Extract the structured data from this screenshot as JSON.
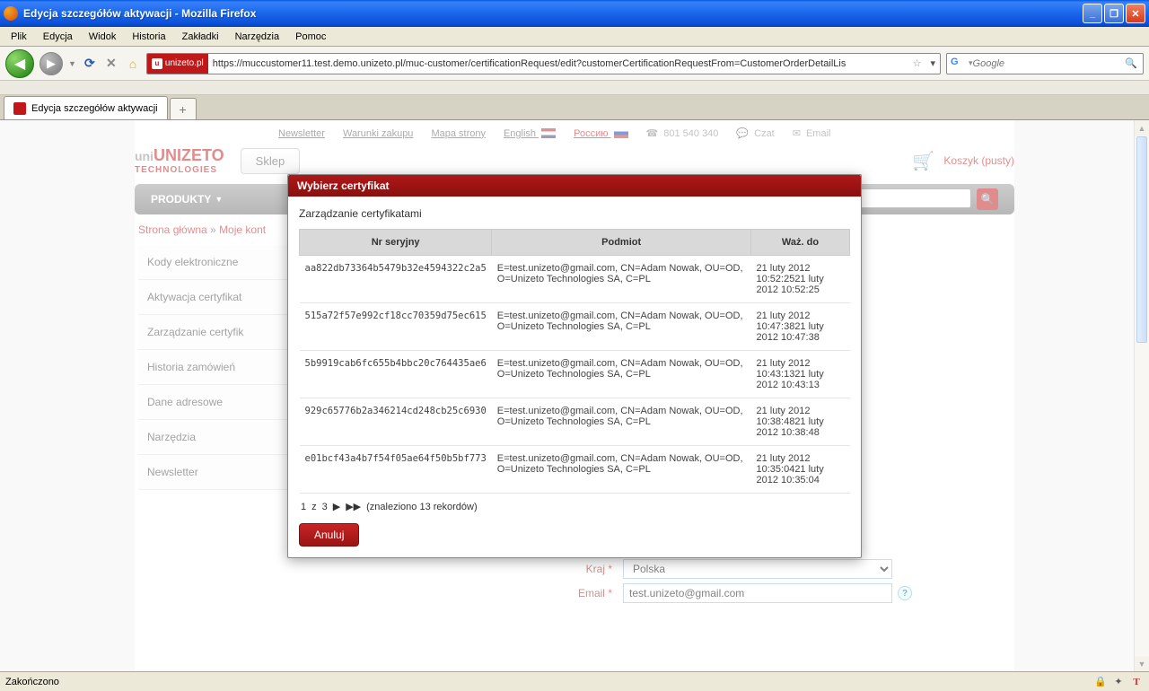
{
  "window": {
    "title": "Edycja szczegółów aktywacji - Mozilla Firefox"
  },
  "menubar": {
    "items": [
      "Plik",
      "Edycja",
      "Widok",
      "Historia",
      "Zakładki",
      "Narzędzia",
      "Pomoc"
    ]
  },
  "toolbar": {
    "site_id": "unizeto.pl",
    "url": "https://muccustomer11.test.demo.unizeto.pl/muc-customer/certificationRequest/edit?customerCertificationRequestFrom=CustomerOrderDetailLis",
    "search_placeholder": "Google"
  },
  "tabs": {
    "active_title": "Edycja szczegółów aktywacji"
  },
  "page": {
    "toplinks": {
      "newsletter": "Newsletter",
      "warunki": "Warunki zakupu",
      "mapa": "Mapa strony",
      "english": "English",
      "russian": "Россию",
      "phone": "801 540 340",
      "czat": "Czat",
      "email": "Email"
    },
    "logo_line1": "UNIZETO",
    "logo_line2": "TECHNOLOGIES",
    "sklep": "Sklep",
    "cart": "Koszyk (pusty)",
    "navbar": {
      "produkty": "PRODUKTY"
    },
    "breadcrumb": {
      "home": "Strona główna",
      "sep": " » ",
      "current": "Moje kont"
    },
    "sidenav": [
      "Kody elektroniczne",
      "Aktywacja certyfikat",
      "Zarządzanie certyfik",
      "Historia zamówień",
      "Dane adresowe",
      "Narzędzia",
      "Newsletter"
    ]
  },
  "modal": {
    "title": "Wybierz certyfikat",
    "subtitle": "Zarządzanie certyfikatami",
    "headers": {
      "serial": "Nr seryjny",
      "subject": "Podmiot",
      "valid": "Waż. do"
    },
    "rows": [
      {
        "serial": "aa822db73364b5479b32e4594322c2a5",
        "subject": "E=test.unizeto@gmail.com, CN=Adam Nowak, OU=OD, O=Unizeto Technologies SA, C=PL",
        "valid": "21 luty 2012 10:52:2521 luty 2012 10:52:25"
      },
      {
        "serial": "515a72f57e992cf18cc70359d75ec615",
        "subject": "E=test.unizeto@gmail.com, CN=Adam Nowak, OU=OD, O=Unizeto Technologies SA, C=PL",
        "valid": "21 luty 2012 10:47:3821 luty 2012 10:47:38"
      },
      {
        "serial": "5b9919cab6fc655b4bbc20c764435ae6",
        "subject": "E=test.unizeto@gmail.com, CN=Adam Nowak, OU=OD, O=Unizeto Technologies SA, C=PL",
        "valid": "21 luty 2012 10:43:1321 luty 2012 10:43:13"
      },
      {
        "serial": "929c65776b2a346214cd248cb25c6930",
        "subject": "E=test.unizeto@gmail.com, CN=Adam Nowak, OU=OD, O=Unizeto Technologies SA, C=PL",
        "valid": "21 luty 2012 10:38:4821 luty 2012 10:38:48"
      },
      {
        "serial": "e01bcf43a4b7f54f05ae64f50b5bf773",
        "subject": "E=test.unizeto@gmail.com, CN=Adam Nowak, OU=OD, O=Unizeto Technologies SA, C=PL",
        "valid": "21 luty 2012 10:35:0421 luty 2012 10:35:04"
      }
    ],
    "pager": {
      "current": "1",
      "sep": "z",
      "total": "3",
      "found": "(znaleziono 13 rekordów)"
    },
    "cancel": "Anuluj"
  },
  "form": {
    "kraj_label": "Kraj",
    "kraj_value": "Polska",
    "email_label": "Email",
    "email_value": "test.unizeto@gmail.com"
  },
  "status": {
    "text": "Zakończono"
  }
}
